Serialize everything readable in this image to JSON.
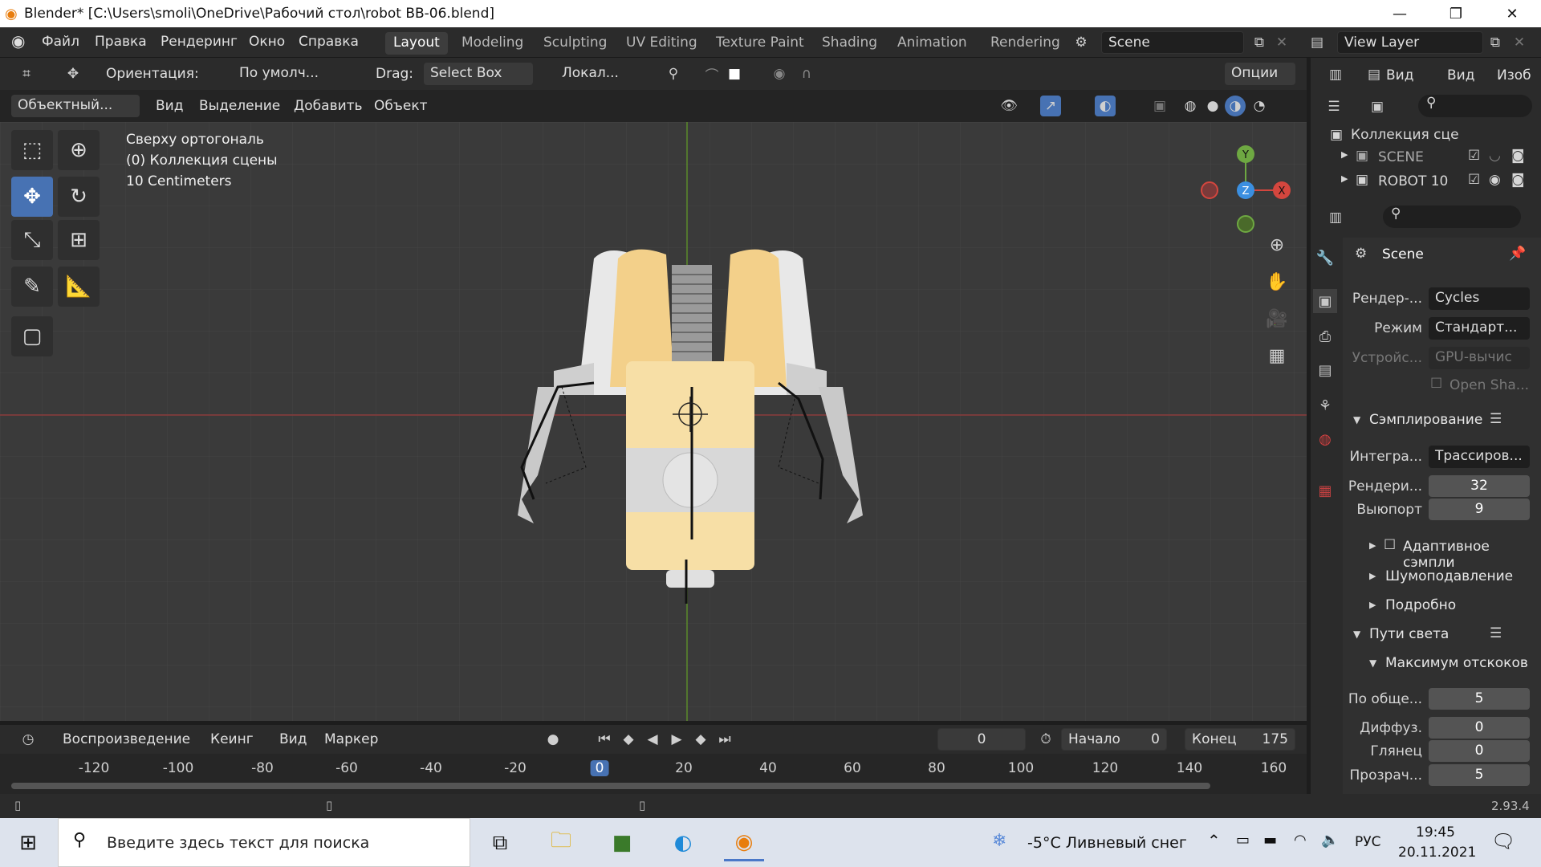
{
  "titlebar": {
    "title": "Blender* [C:\\Users\\smoli\\OneDrive\\Рабочий стол\\robot BB-06.blend]"
  },
  "menu": [
    "Файл",
    "Правка",
    "Рендеринг",
    "Окно",
    "Справка"
  ],
  "workspaces": [
    "Layout",
    "Modeling",
    "Sculpting",
    "UV Editing",
    "Texture Paint",
    "Shading",
    "Animation",
    "Rendering"
  ],
  "scene": {
    "label": "Scene"
  },
  "viewlayer": {
    "label": "View Layer"
  },
  "toolhdr": {
    "orientation_label": "Ориентация:",
    "orientation_value": "По умолч...",
    "drag_label": "Drag:",
    "drag_value": "Select Box",
    "pivot": "Локал...",
    "options": "Опции"
  },
  "vphdr": {
    "mode": "Объектный...",
    "items": [
      "Вид",
      "Выделение",
      "Добавить",
      "Объект"
    ]
  },
  "overlay": {
    "view": "Сверху ортогональ",
    "collection": "(0) Коллекция сцены",
    "scale": "10 Centimeters"
  },
  "gizmo": {
    "y": "Y",
    "z": "Z",
    "x": "X"
  },
  "editorhdr": {
    "view1": "Вид",
    "view2": "Вид",
    "image": "Изоб"
  },
  "outliner": {
    "root": "Коллекция сце",
    "items": [
      {
        "label": "SCENE"
      },
      {
        "label": "ROBOT 10"
      }
    ]
  },
  "props": {
    "scene": "Scene",
    "render_engine_label": "Рендер-...",
    "render_engine": "Cycles",
    "mode_label": "Режим",
    "mode": "Стандарт...",
    "device_label": "Устройс...",
    "device": "GPU-вычис",
    "open_shading": "Open Sha...",
    "sampling": "Сэмплирование",
    "integrator_label": "Интегра...",
    "integrator": "Трассиров...",
    "render_label": "Рендери...",
    "render_samples": "32",
    "viewport_label": "Выюпорт",
    "viewport_samples": "9",
    "adaptive": "Адаптивное сэмпли",
    "denoise": "Шумоподавление",
    "advanced": "Подробно",
    "light_paths": "Пути света",
    "max_bounces": "Максимум отскоков",
    "total_label": "По обще...",
    "total": "5",
    "diffuse_label": "Диффуз.",
    "diffuse": "0",
    "glossy_label": "Глянец",
    "glossy": "0",
    "transp_label": "Прозрач...",
    "transp": "5"
  },
  "timeline": {
    "playback": "Воспроизведение",
    "keying": "Кеинг",
    "view": "Вид",
    "marker": "Маркер",
    "current": "0",
    "start_label": "Начало",
    "start": "0",
    "end_label": "Конец",
    "end": "175",
    "ticks": [
      "-120",
      "-100",
      "-80",
      "-60",
      "-40",
      "-20",
      "0",
      "20",
      "40",
      "60",
      "80",
      "100",
      "120",
      "140",
      "160"
    ]
  },
  "status": {
    "version": "2.93.4"
  },
  "taskbar": {
    "search": "Введите здесь текст для поиска",
    "weather": "-5°C  Ливневый снег",
    "lang": "РУС",
    "time": "19:45",
    "date": "20.11.2021"
  }
}
